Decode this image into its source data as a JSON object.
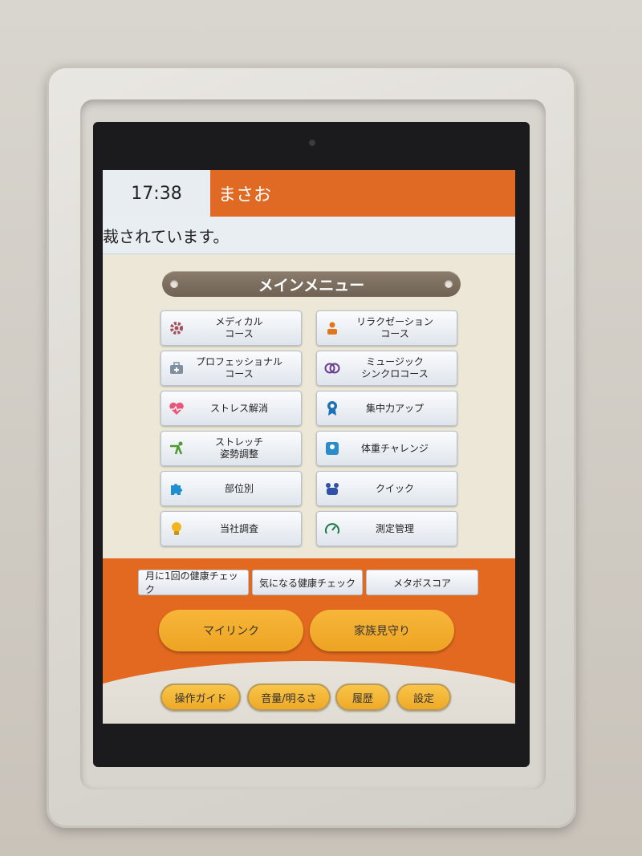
{
  "status": {
    "time": "17:38",
    "user_name": "まさお",
    "scroll_message": "裁されています。"
  },
  "main_menu": {
    "title": "メインメニュー",
    "items": [
      {
        "label": "メディカル\nコース",
        "icon": "gear-icon"
      },
      {
        "label": "リラクゼーション\nコース",
        "icon": "person-icon"
      },
      {
        "label": "プロフェッショナル\nコース",
        "icon": "medical-bag-icon"
      },
      {
        "label": "ミュージック\nシンクロコース",
        "icon": "rings-icon"
      },
      {
        "label": "ストレス解消",
        "icon": "heart-pulse-icon"
      },
      {
        "label": "集中力アップ",
        "icon": "award-icon"
      },
      {
        "label": "ストレッチ\n姿勢調整",
        "icon": "stretch-icon"
      },
      {
        "label": "体重チャレンジ",
        "icon": "scale-icon"
      },
      {
        "label": "部位別",
        "icon": "puzzle-icon"
      },
      {
        "label": "クイック",
        "icon": "quick-icon"
      },
      {
        "label": "当社調査",
        "icon": "bulb-icon"
      },
      {
        "label": "測定管理",
        "icon": "gauge-icon"
      }
    ]
  },
  "health_checks": [
    "月に1回の健康チェック",
    "気になる健康チェック",
    "メタボスコア"
  ],
  "big_buttons": [
    "マイリンク",
    "家族見守り"
  ],
  "bottom_buttons": [
    "操作ガイド",
    "音量/明るさ",
    "履歴",
    "設定"
  ],
  "colors": {
    "accent": "#e2691f",
    "button_gold": "#f2ae2e",
    "menu_title": "#7c6e60"
  }
}
